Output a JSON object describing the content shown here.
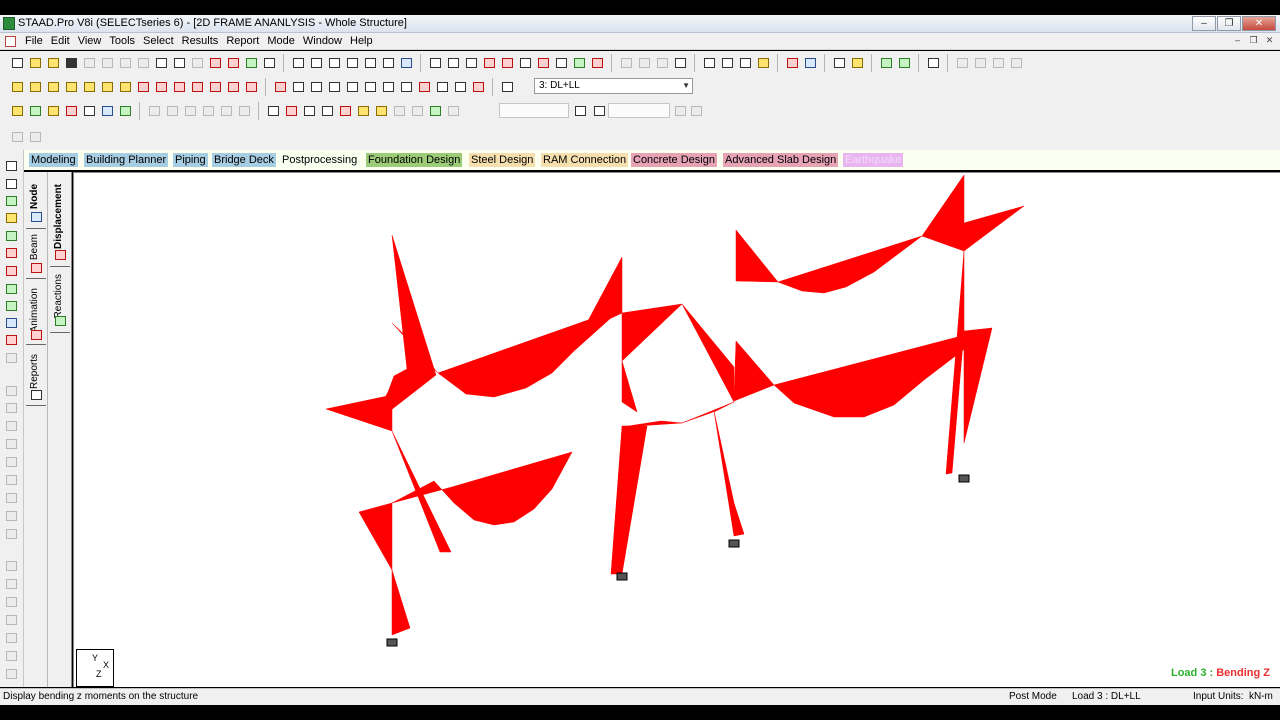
{
  "window": {
    "title": "STAAD.Pro V8i (SELECTseries 6) - [2D FRAME ANANLYSIS - Whole Structure]",
    "minimize": "–",
    "restore": "❐",
    "close": "✕"
  },
  "menubar": {
    "items": [
      "File",
      "Edit",
      "View",
      "Tools",
      "Select",
      "Results",
      "Report",
      "Mode",
      "Window",
      "Help"
    ],
    "mdi": [
      "–",
      "❐",
      "✕"
    ]
  },
  "toolbar": {
    "load_case": "3: DL+LL",
    "load_case_arrow": "▼"
  },
  "page_tabs": [
    {
      "label": "Modeling",
      "color": "#a7cde3"
    },
    {
      "label": "Building Planner",
      "color": "#a7cde3"
    },
    {
      "label": "Piping",
      "color": "#a7cde3"
    },
    {
      "label": "Bridge Deck",
      "color": "#a7cde3"
    },
    {
      "label": "Postprocessing",
      "color": "#fafff0",
      "active": true
    },
    {
      "label": "Foundation Design",
      "color": "#9ccc78"
    },
    {
      "label": "Steel Design",
      "color": "#f6dfae"
    },
    {
      "label": "RAM Connection",
      "color": "#f6dfae"
    },
    {
      "label": "Concrete Design",
      "color": "#e6a3b5"
    },
    {
      "label": "Advanced Slab Design",
      "color": "#e6a3b5"
    },
    {
      "label": "Earthquake",
      "color": "#e9b5f0",
      "disabled": true
    }
  ],
  "side_tabs_outer": [
    "Node",
    "Beam",
    "Animation",
    "Reports"
  ],
  "side_tabs_inner": [
    "Displacement",
    "Reactions"
  ],
  "canvas": {
    "axis_y": "Y",
    "axis_x": "X",
    "axis_z": "Z",
    "load_prefix": "Load 3 :",
    "load_type": "Bending Z",
    "diagram_color": "#ff0000"
  },
  "statusbar": {
    "message": "Display bending z moments on the structure",
    "mode": "Post Mode",
    "load": "Load 3 : DL+LL",
    "units_label": "Input Units:",
    "units": "kN-m"
  }
}
